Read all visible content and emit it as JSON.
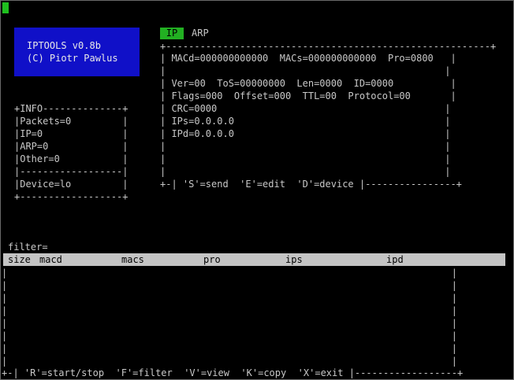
{
  "app": {
    "title": "IPTOOLS v0.8b",
    "author": "(C) Piotr Pawlus"
  },
  "tabs": [
    {
      "label": "IP",
      "active": true
    },
    {
      "label": "ARP",
      "active": false
    }
  ],
  "packet_panel": {
    "top_border": "+---------------------------------------------------------+",
    "rows": [
      "| MACd=000000000000  MACs=000000000000  Pro=0800   |",
      "|                                                 |",
      "| Ver=00  ToS=00000000  Len=0000  ID=0000          |",
      "| Flags=000  Offset=000  TTL=00  Protocol=00       |",
      "| CRC=0000                                        |",
      "| IPs=0.0.0.0                                     |",
      "| IPd=0.0.0.0                                     |",
      "|                                                 |",
      "|                                                 |",
      "|                                                 |"
    ],
    "bottom_border": "+-| 'S'=send  'E'=edit  'D'=device |----------------+"
  },
  "info_panel": {
    "lines": [
      "+INFO--------------+",
      "|Packets=0         |",
      "|IP=0              |",
      "|ARP=0             |",
      "|Other=0           |",
      "|------------------|",
      "|Device=lo         |",
      "+------------------+"
    ]
  },
  "filter": {
    "label": "filter=",
    "value": ""
  },
  "table": {
    "columns": [
      "size",
      "macd",
      "macs",
      "pro",
      "ips",
      "ipd"
    ],
    "empty_rows": [
      "|                                                                              |",
      "|                                                                              |",
      "|                                                                              |",
      "|                                                                              |",
      "|                                                                              |",
      "|                                                                              |",
      "|                                                                              |",
      "|                                                                              |"
    ]
  },
  "footer": "+-| 'R'=start/stop  'F'=filter  'V'=view  'K'=copy  'X'=exit |------------------+",
  "colors": {
    "background": "#000000",
    "text": "#c8c8c8",
    "title_box": "#1010c8",
    "active_tab": "#22b022",
    "header_bar": "#c4c4c4",
    "cursor": "#1fbf1f"
  }
}
